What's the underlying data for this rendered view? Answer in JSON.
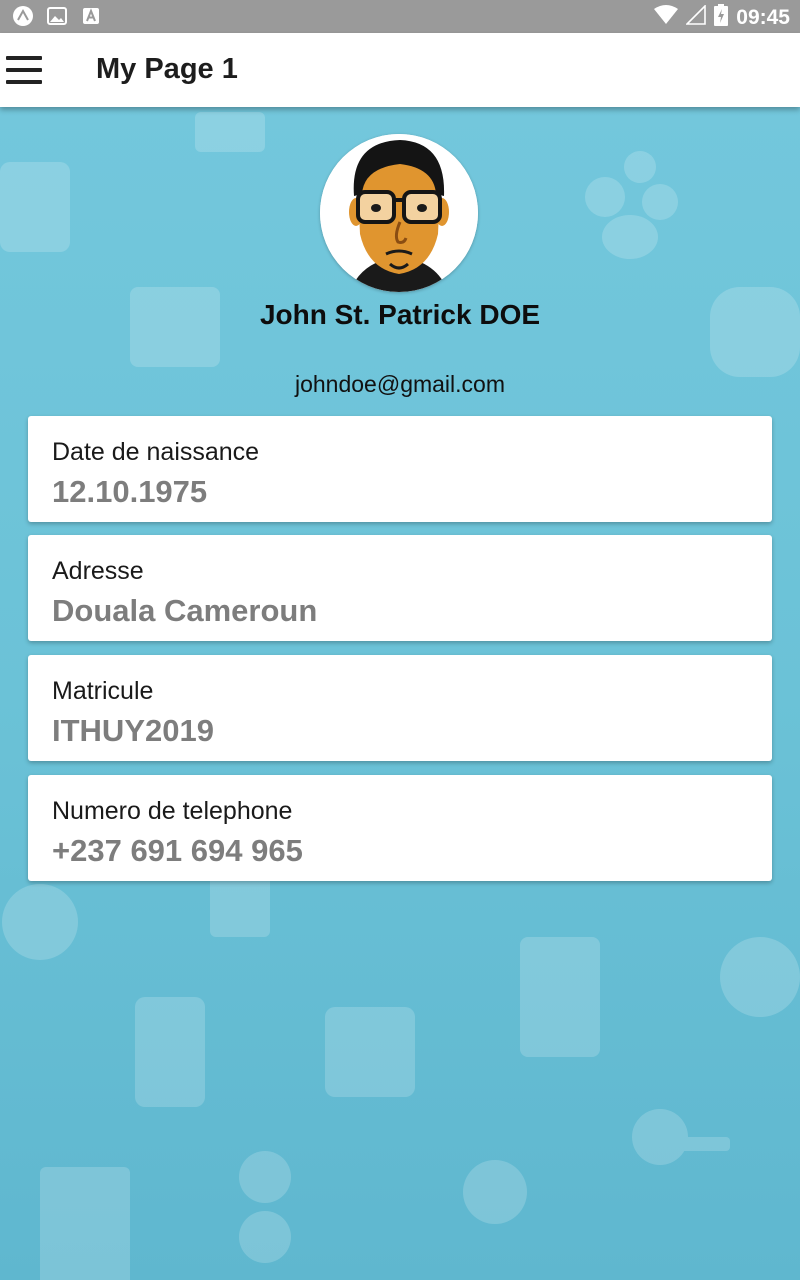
{
  "status_bar": {
    "time": "09:45",
    "icons": [
      "app-icon",
      "image-icon",
      "font-icon",
      "wifi-icon",
      "signal-icon",
      "battery-icon"
    ]
  },
  "app_bar": {
    "title": "My Page 1",
    "menu_icon": "hamburger-menu-icon"
  },
  "profile": {
    "name": "John St. Patrick DOE",
    "email": "johndoe@gmail.com",
    "avatar_icon": "avatar-cartoon"
  },
  "cards": [
    {
      "label": "Date de naissance",
      "value": "12.10.1975"
    },
    {
      "label": "Adresse",
      "value": "Douala Cameroun"
    },
    {
      "label": "Matricule",
      "value": "ITHUY2019"
    },
    {
      "label": "Numero de telephone",
      "value": "+237 691 694 965"
    }
  ],
  "colors": {
    "background": "#6bc2d7",
    "status_bar": "#9a9a9a",
    "value_text": "#7d7d7d"
  }
}
